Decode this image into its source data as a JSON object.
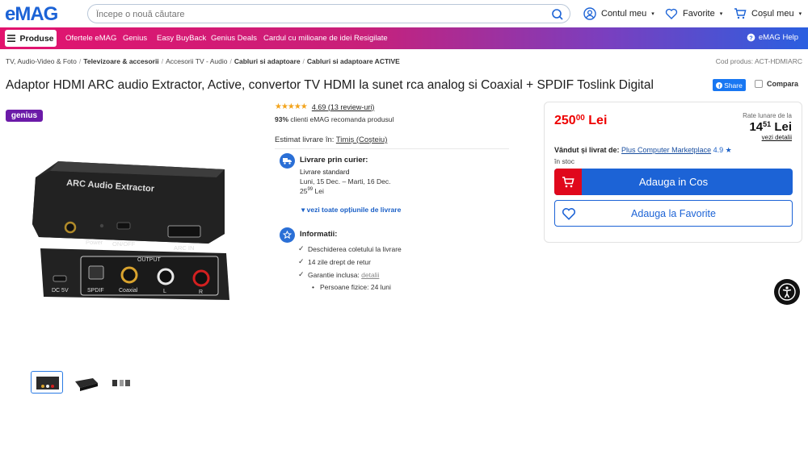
{
  "header": {
    "logo_text": "eMAG",
    "search_placeholder": "Începe o nouă căutare",
    "account_label": "Contul meu",
    "favorites_label": "Favorite",
    "cart_label": "Coșul meu"
  },
  "nav": {
    "produse": "Produse",
    "links": [
      "Ofertele eMAG",
      "Genius",
      "Easy BuyBack",
      "Genius Deals",
      "Cardul cu milioane de idei",
      "Resigilate"
    ],
    "help": "eMAG Help"
  },
  "breadcrumb": {
    "items": [
      "TV, Audio-Video & Foto",
      "Televizoare & accesorii",
      "Accesorii TV - Audio",
      "Cabluri si adaptoare",
      "Cabluri si adaptoare ACTIVE"
    ],
    "code": "Cod produs: ACT-HDMIARC"
  },
  "product": {
    "title": "Adaptor HDMI ARC audio Extractor, Active, convertor TV HDMI la sunet rca analog si Coaxial + SPDIF Toslink Digital",
    "share": "Share",
    "compare": "Compara",
    "genius_badge": "genius",
    "stars": "★★★★★",
    "rating": "4.69",
    "reviews": "(13 review-uri)",
    "recommend_pct": "93%",
    "recommend_text": "clienti eMAG recomanda produsul",
    "estimate_label": "Estimat livrare în:",
    "estimate_location": "Timiș (Coșteiu)",
    "image_texts": {
      "brand": "ARC Audio Extractor",
      "power": "Power",
      "onoff": "ON/OFF",
      "arc_in": "ARC IN",
      "output": "OUTPUT",
      "dc": "DC 5V",
      "spdif": "SPDIF",
      "coaxial": "Coaxial",
      "l": "L",
      "r": "R"
    }
  },
  "delivery": {
    "title": "Livrare prin curier:",
    "type": "Livrare standard",
    "dates": "Luni, 15 Dec. – Marti, 16 Dec.",
    "cost_int": "25",
    "cost_dec": "99",
    "cost_currency": "Lei",
    "more": "▾ vezi toate opțiunile de livrare"
  },
  "info": {
    "title": "Informatii:",
    "items": [
      "Deschiderea coletului la livrare",
      "14 zile drept de retur",
      "Garantie inclusa:"
    ],
    "details_link": "detalii",
    "sub": "Persoane fizice: 24 luni"
  },
  "buybox": {
    "price_int": "250",
    "price_dec": "00",
    "currency": "Lei",
    "rate_label": "Rate lunare de la",
    "rate_int": "14",
    "rate_dec": "51",
    "rate_currency": "Lei",
    "rate_link": "vezi detalii",
    "sold_label": "Vândut și livrat de:",
    "seller": "Plus Computer Marketplace",
    "seller_score": "4.9 ★",
    "stock": "în stoc",
    "add_cart": "Adauga in Cos",
    "add_fav": "Adauga la Favorite"
  },
  "colors": {
    "brand_blue": "#1c63d6",
    "price_red": "#e00",
    "genius_purple": "#6b1aa8"
  }
}
